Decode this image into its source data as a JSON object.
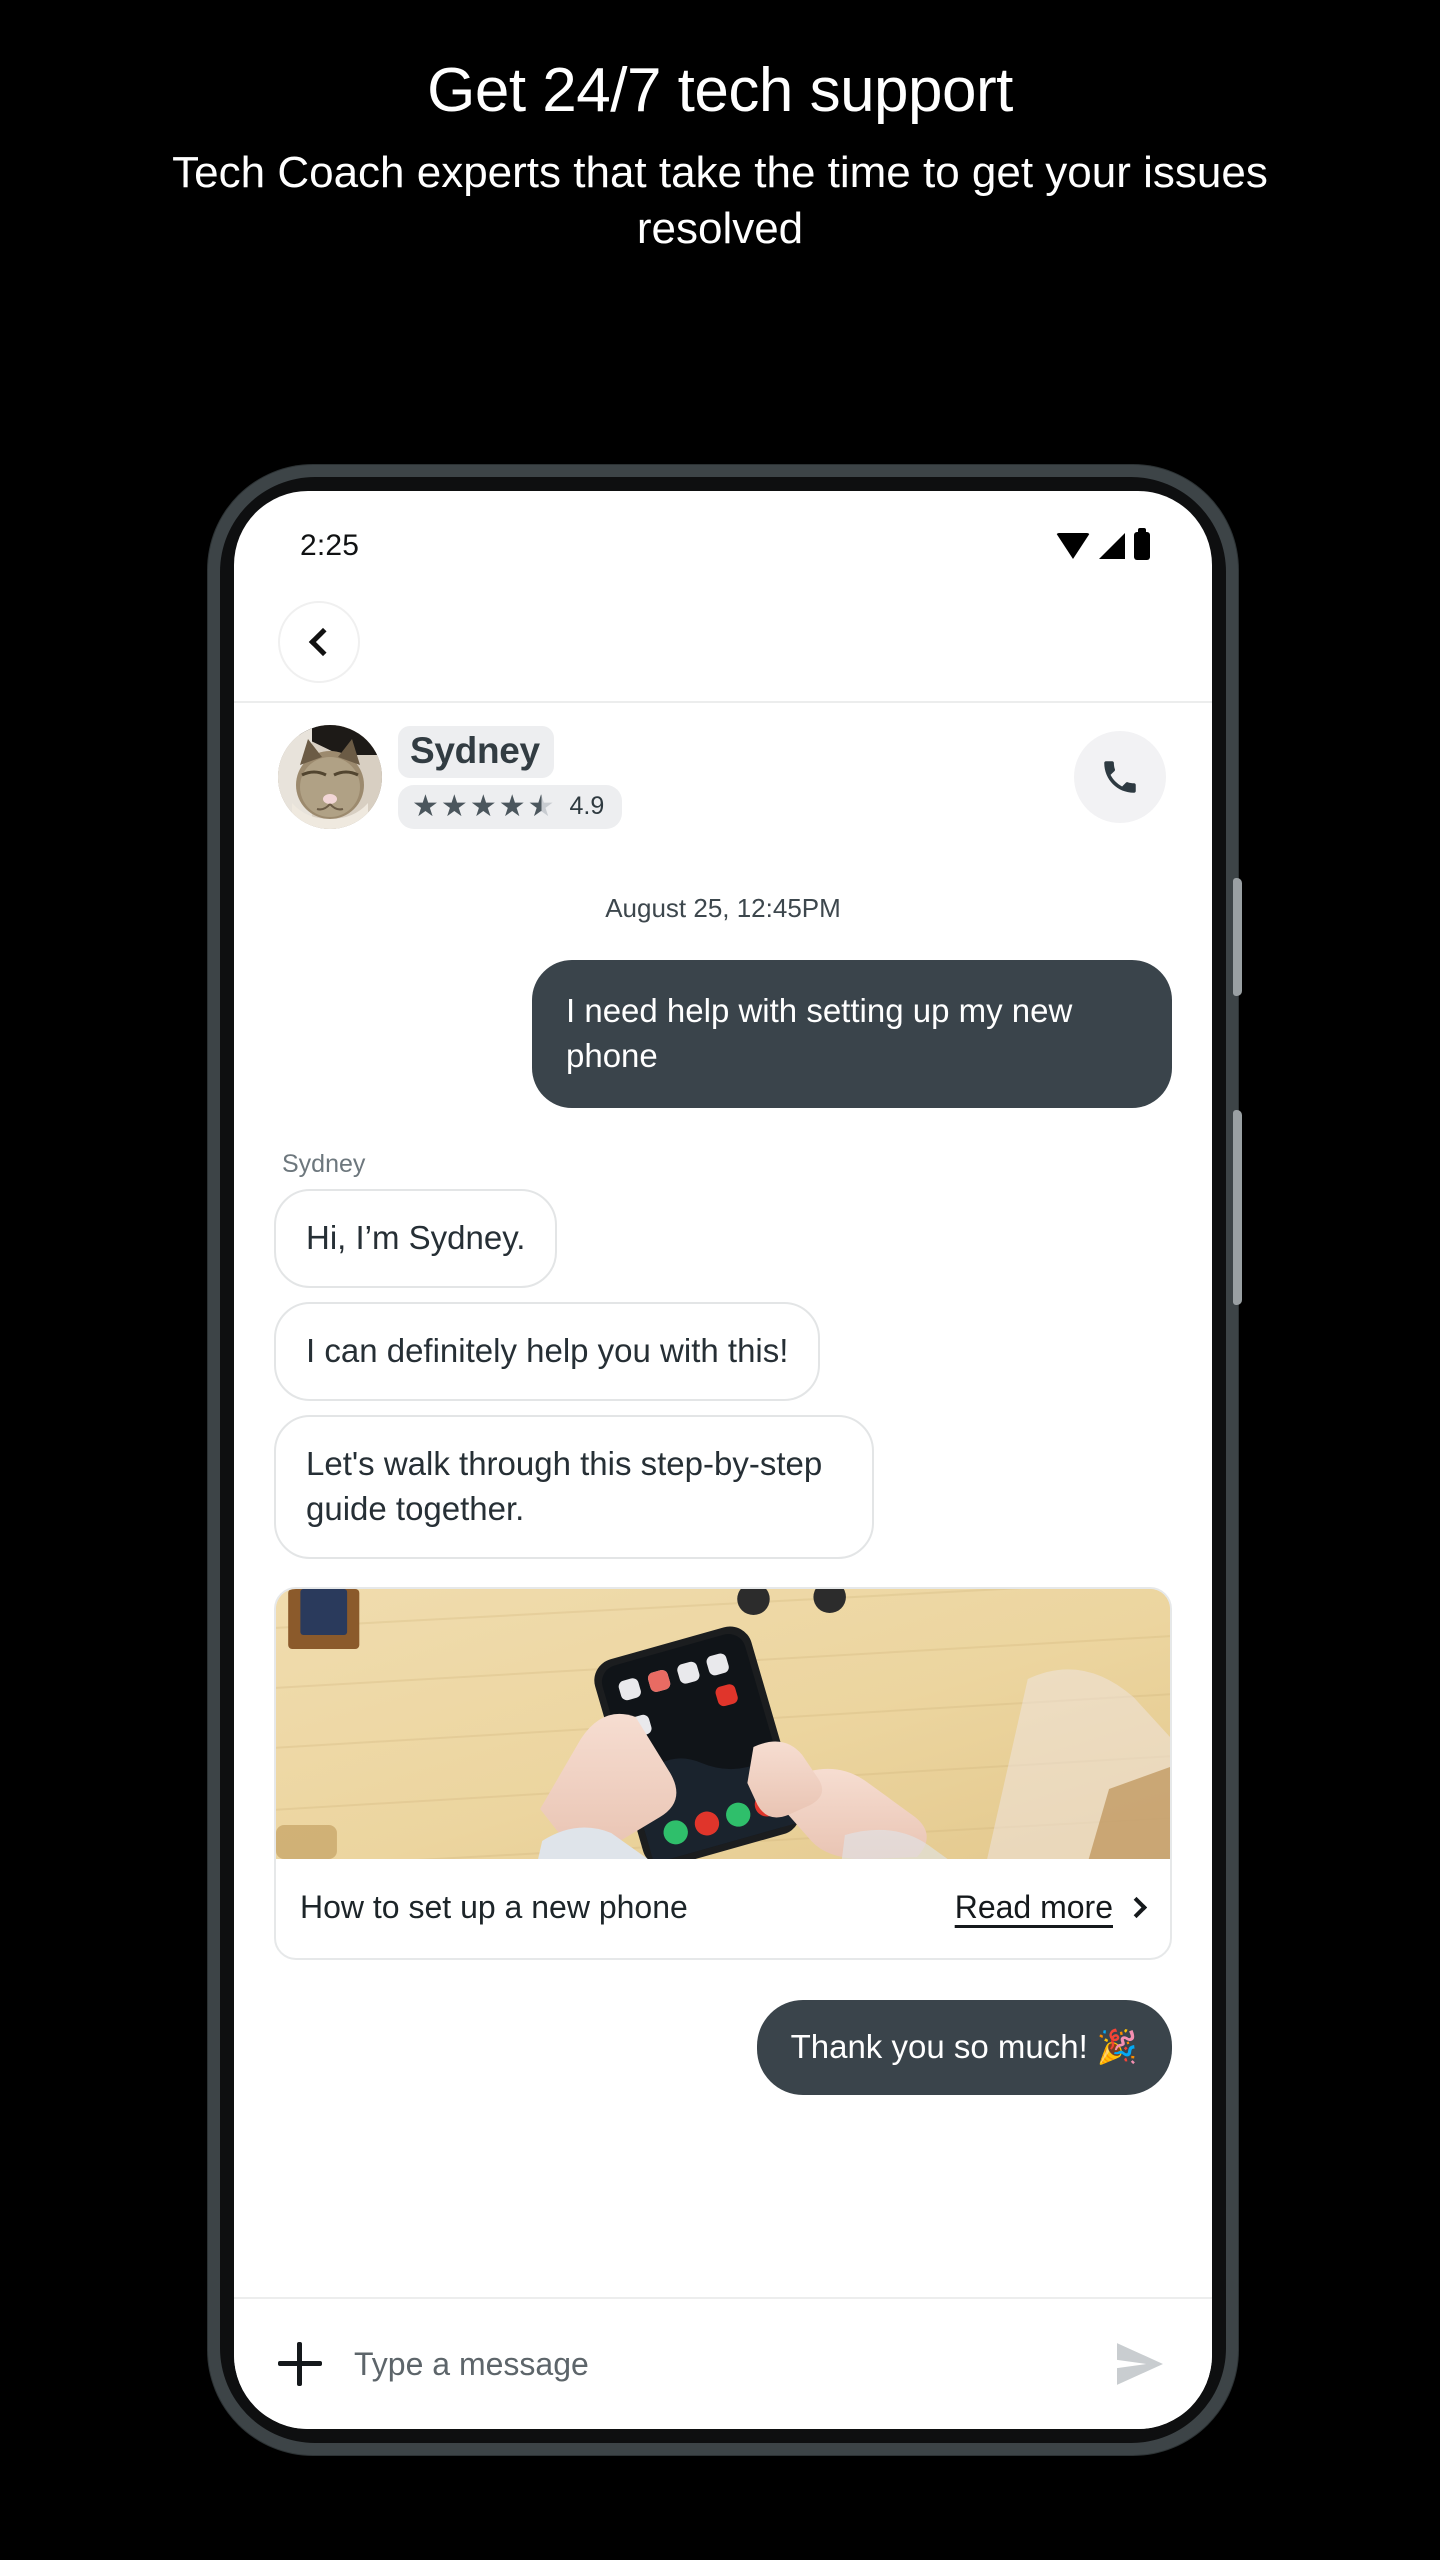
{
  "promo": {
    "title": "Get 24/7 tech support",
    "subtitle": "Tech Coach experts that take the time to get your issues resolved"
  },
  "colors": {
    "background": "#000000",
    "outgoing_bubble": "#3a444b",
    "incoming_bubble_border": "#e3e5e6",
    "pill_background": "#edeef0",
    "phone_frame": "#3d4447",
    "accent_text": "#ffffff"
  },
  "phone": {
    "status_bar": {
      "time": "2:25",
      "icons": [
        "wifi-icon",
        "signal-icon",
        "battery-icon"
      ]
    },
    "nav": {
      "back_icon": "chevron-left-icon"
    },
    "agent": {
      "avatar_alt": "cat-avatar",
      "name": "Sydney",
      "rating_value": "4.9",
      "stars_filled": 4,
      "stars_half": 1,
      "stars_total": 5,
      "call_icon": "phone-icon"
    },
    "conversation": {
      "timestamp": "August 25, 12:45PM",
      "messages": [
        {
          "direction": "out",
          "text": "I need help with setting up my new phone"
        },
        {
          "direction": "in",
          "sender": "Sydney",
          "text": "Hi, I’m Sydney."
        },
        {
          "direction": "in",
          "text": "I can definitely help you with this!"
        },
        {
          "direction": "in",
          "text": "Let's walk through this step-by-step guide together."
        }
      ],
      "card": {
        "image_alt": "hands-holding-phone-over-wooden-table",
        "title": "How to set up a new phone",
        "link_label": "Read more",
        "link_icon": "chevron-right-icon"
      },
      "last_message": {
        "direction": "out",
        "text": "Thank you so much! 🎉"
      }
    },
    "composer": {
      "attach_icon": "plus-icon",
      "placeholder": "Type a message",
      "value": "",
      "send_icon": "send-icon"
    }
  }
}
